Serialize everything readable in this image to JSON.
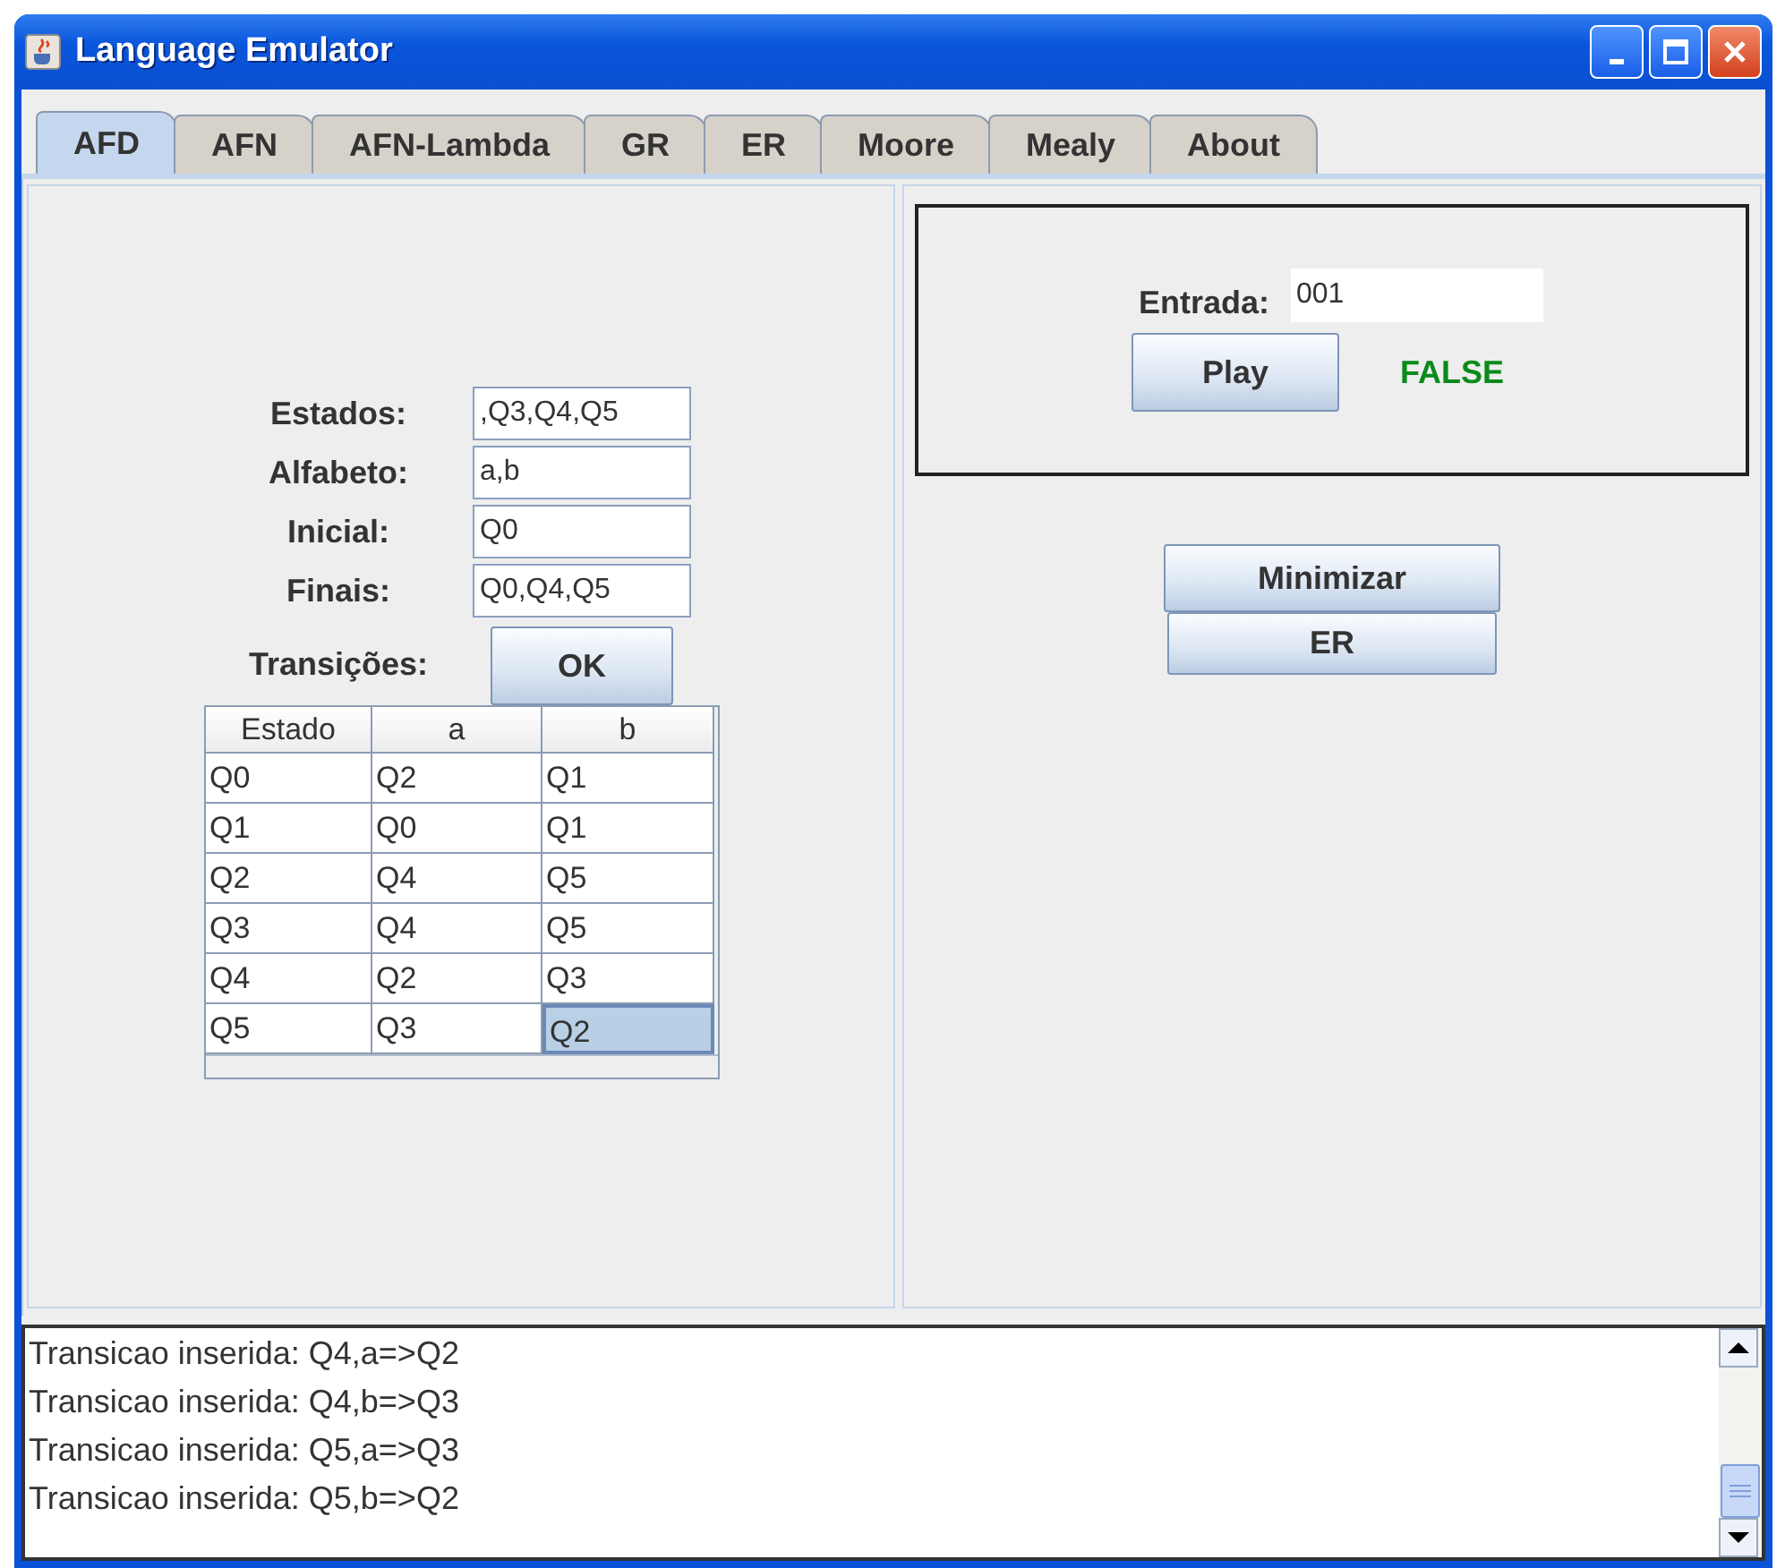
{
  "window": {
    "title": "Language Emulator"
  },
  "tabs": [
    {
      "label": "AFD",
      "selected": true
    },
    {
      "label": "AFN",
      "selected": false
    },
    {
      "label": "AFN-Lambda",
      "selected": false
    },
    {
      "label": "GR",
      "selected": false
    },
    {
      "label": "ER",
      "selected": false
    },
    {
      "label": "Moore",
      "selected": false
    },
    {
      "label": "Mealy",
      "selected": false
    },
    {
      "label": "About",
      "selected": false
    }
  ],
  "form": {
    "fields": [
      {
        "label": "Estados:",
        "value": ",Q3,Q4,Q5"
      },
      {
        "label": "Alfabeto:",
        "value": "a,b"
      },
      {
        "label": "Inicial:",
        "value": "Q0"
      },
      {
        "label": "Finais:",
        "value": "Q0,Q4,Q5"
      }
    ],
    "transitions_label": "Transições:",
    "ok_button": "OK"
  },
  "table": {
    "columns": [
      "Estado",
      "a",
      "b"
    ],
    "rows": [
      {
        "cells": [
          {
            "text": "Q0",
            "selected": false
          },
          {
            "text": "Q2",
            "selected": false
          },
          {
            "text": "Q1",
            "selected": false
          }
        ]
      },
      {
        "cells": [
          {
            "text": "Q1",
            "selected": false
          },
          {
            "text": "Q0",
            "selected": false
          },
          {
            "text": "Q1",
            "selected": false
          }
        ]
      },
      {
        "cells": [
          {
            "text": "Q2",
            "selected": false
          },
          {
            "text": "Q4",
            "selected": false
          },
          {
            "text": "Q5",
            "selected": false
          }
        ]
      },
      {
        "cells": [
          {
            "text": "Q3",
            "selected": false
          },
          {
            "text": "Q4",
            "selected": false
          },
          {
            "text": "Q5",
            "selected": false
          }
        ]
      },
      {
        "cells": [
          {
            "text": "Q4",
            "selected": false
          },
          {
            "text": "Q2",
            "selected": false
          },
          {
            "text": "Q3",
            "selected": false
          }
        ]
      },
      {
        "cells": [
          {
            "text": "Q5",
            "selected": false
          },
          {
            "text": "Q3",
            "selected": false
          },
          {
            "text": "Q2",
            "selected": true
          }
        ]
      }
    ]
  },
  "simulation": {
    "input_label": "Entrada:",
    "input_value": "001",
    "play_button": "Play",
    "result": "FALSE"
  },
  "actions": [
    "Minimizar",
    "ER"
  ],
  "log": {
    "lines": [
      "Transicao inserida: Q4,a=>Q2",
      "Transicao inserida: Q4,b=>Q3",
      "Transicao inserida: Q5,a=>Q3",
      "Transicao inserida: Q5,b=>Q2"
    ]
  }
}
